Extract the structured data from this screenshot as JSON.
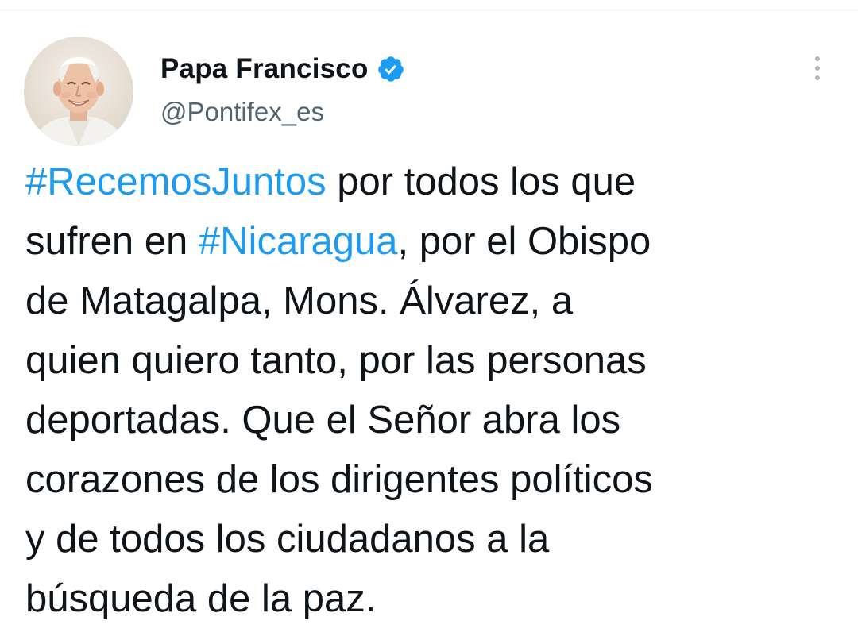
{
  "tweet": {
    "author": {
      "display_name": "Papa Francisco",
      "handle": "@Pontifex_es",
      "verified": true,
      "avatar_icon": "profile-photo"
    },
    "more_icon": "more-vertical-icon",
    "text_lines": [
      [
        {
          "type": "hashtag",
          "text": "#RecemosJuntos"
        },
        {
          "type": "text",
          "text": " por todos los que"
        }
      ],
      [
        {
          "type": "text",
          "text": "sufren en "
        },
        {
          "type": "hashtag",
          "text": "#Nicaragua"
        },
        {
          "type": "text",
          "text": ", por el Obispo"
        }
      ],
      [
        {
          "type": "text",
          "text": "de Matagalpa, Mons. Álvarez, a"
        }
      ],
      [
        {
          "type": "text",
          "text": "quien quiero tanto, por las personas"
        }
      ],
      [
        {
          "type": "text",
          "text": "deportadas. Que el Señor abra los"
        }
      ],
      [
        {
          "type": "text",
          "text": "corazones de los dirigentes políticos"
        }
      ],
      [
        {
          "type": "text",
          "text": "y de todos los ciudadanos a la"
        }
      ],
      [
        {
          "type": "text",
          "text": "búsqueda de la paz."
        }
      ]
    ]
  },
  "colors": {
    "link": "#1d9bf0",
    "text": "#0f1419",
    "secondary": "#536471",
    "verified": "#1d9bf0"
  }
}
